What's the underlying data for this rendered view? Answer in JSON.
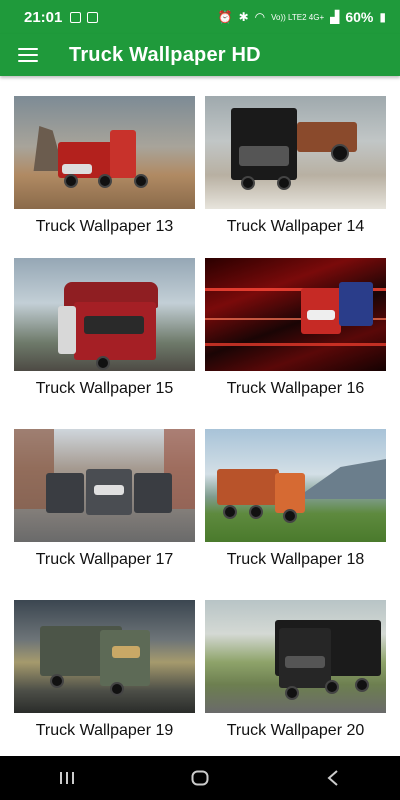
{
  "status": {
    "time": "21:01",
    "network": "Vo)) LTE2 4G+",
    "battery": "60%"
  },
  "appbar": {
    "title": "Truck Wallpaper HD",
    "menu_icon": "hamburger-menu-icon"
  },
  "wallpapers": [
    {
      "label": "Truck Wallpaper 13"
    },
    {
      "label": "Truck Wallpaper 14"
    },
    {
      "label": "Truck Wallpaper 15"
    },
    {
      "label": "Truck Wallpaper 16"
    },
    {
      "label": "Truck Wallpaper 17"
    },
    {
      "label": "Truck Wallpaper 18"
    },
    {
      "label": "Truck Wallpaper 19"
    },
    {
      "label": "Truck Wallpaper 20"
    }
  ],
  "colors": {
    "accent": "#1f9a3b"
  }
}
